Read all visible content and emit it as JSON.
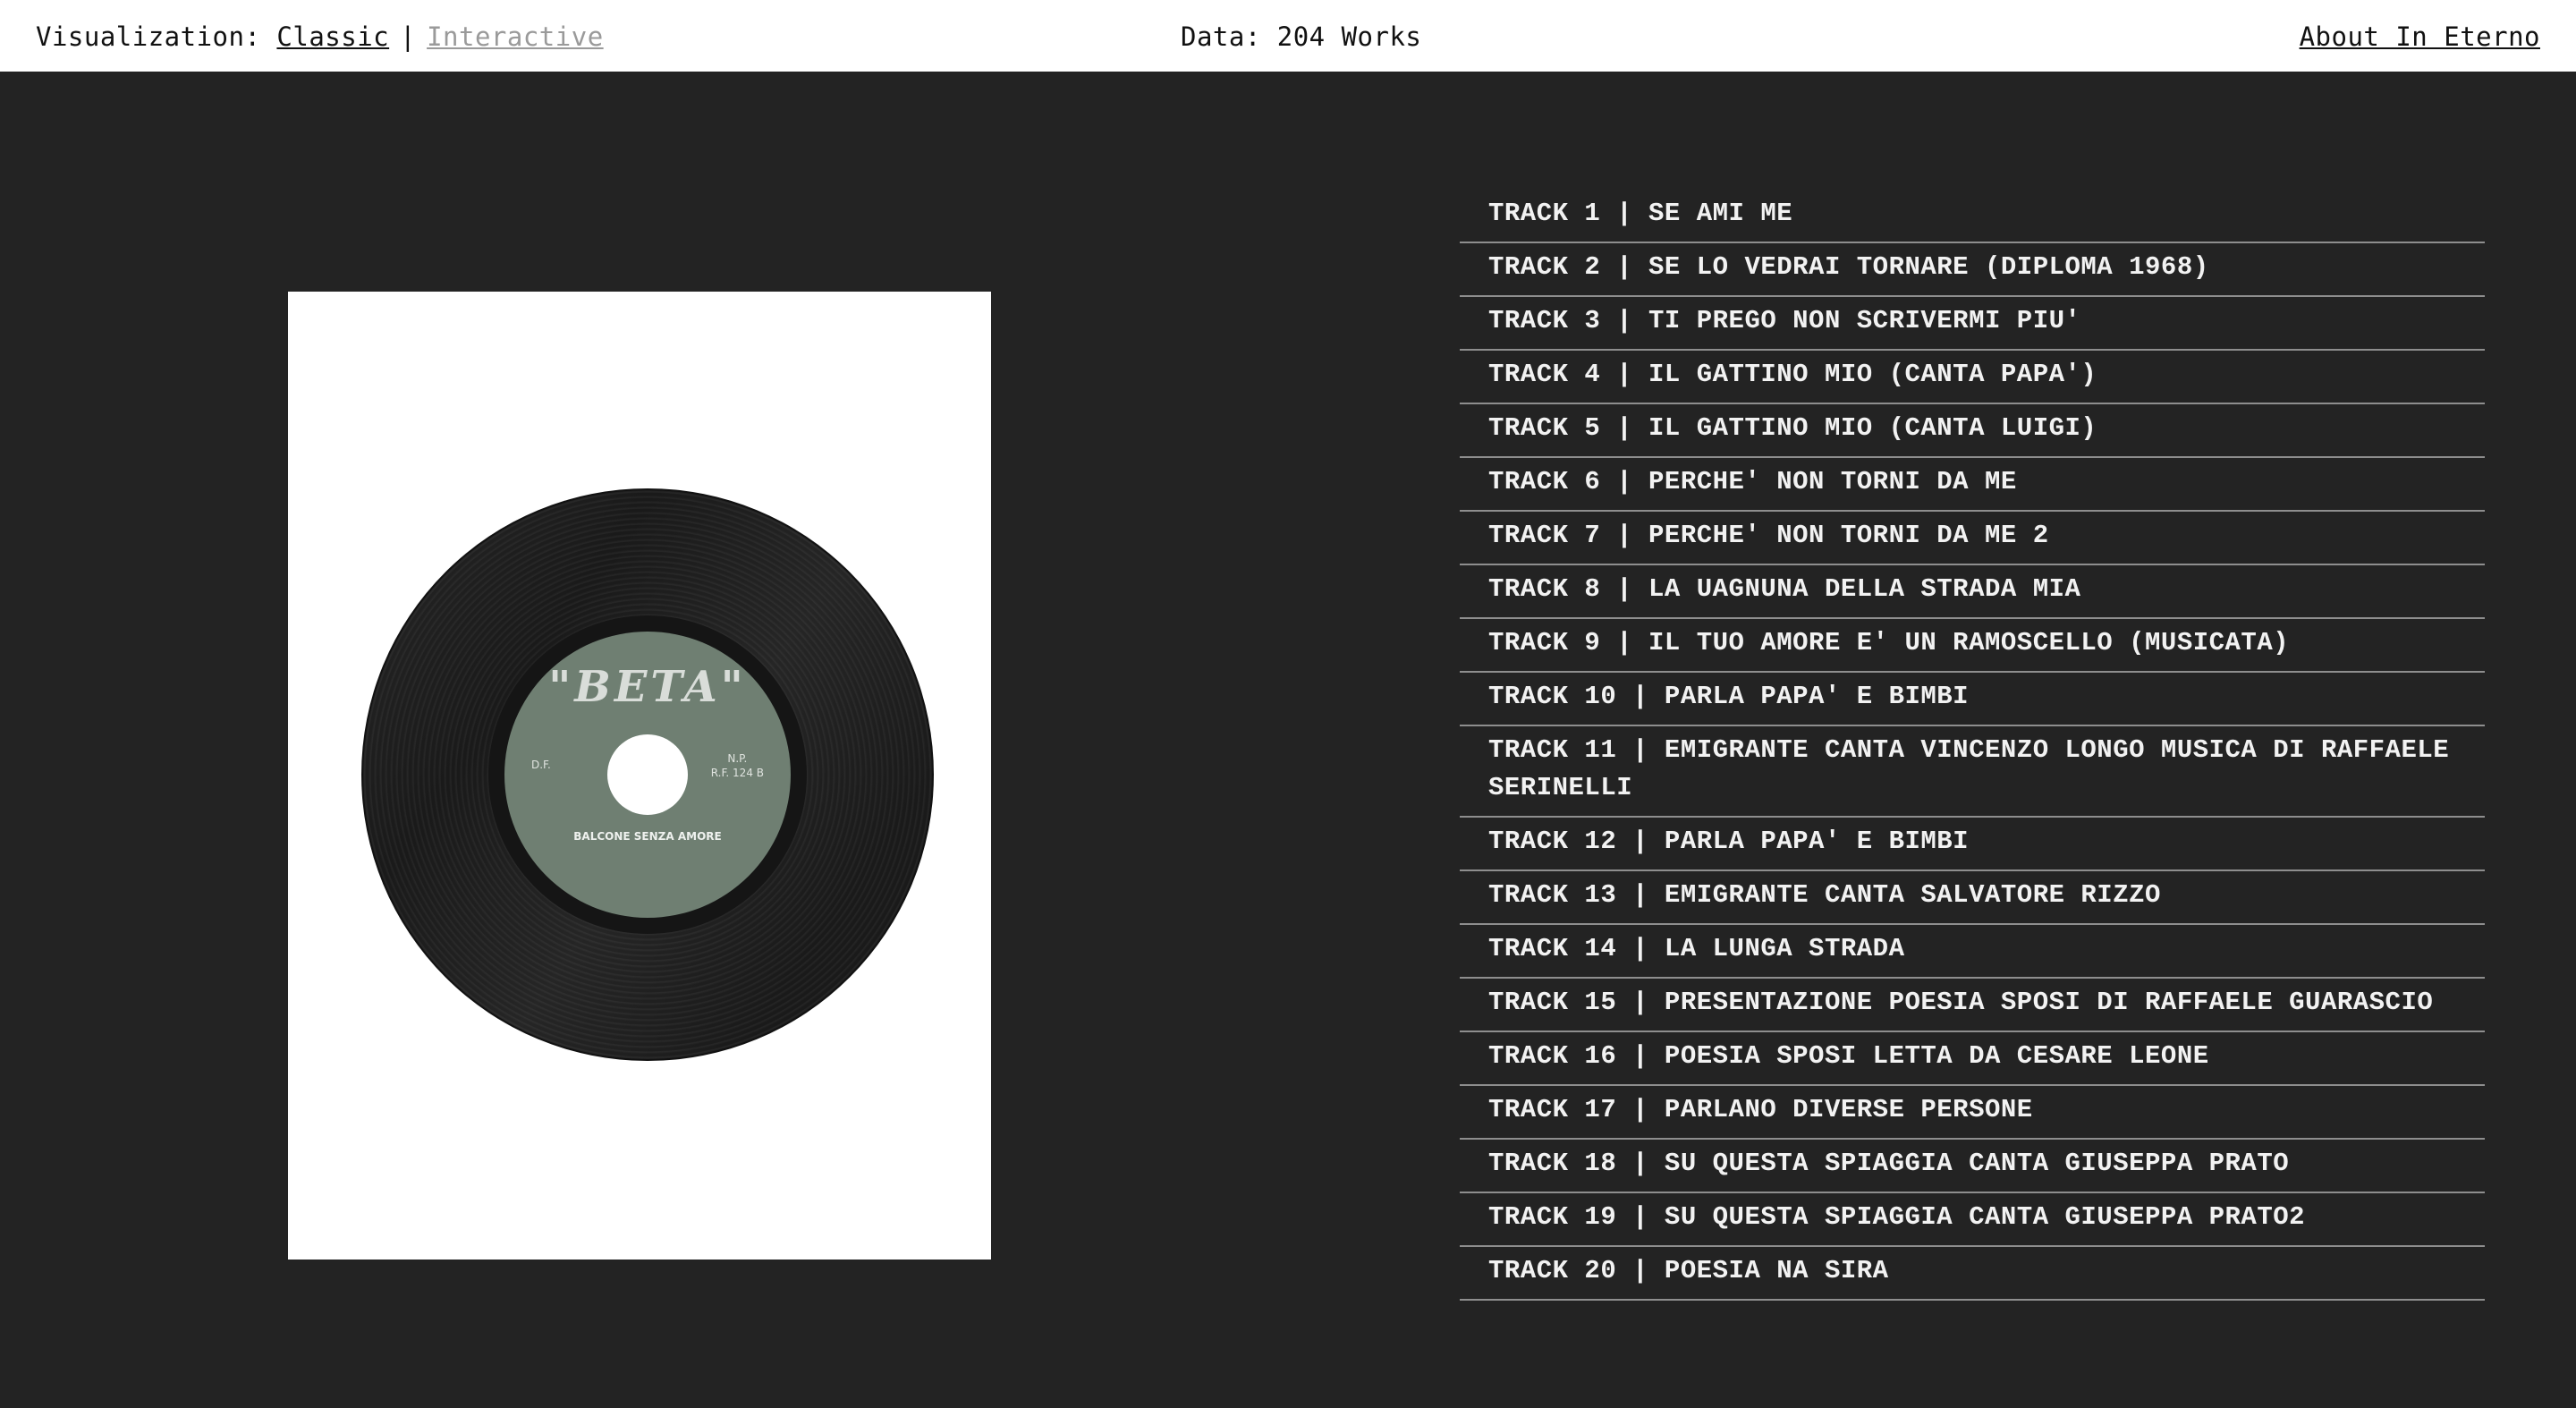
{
  "header": {
    "visualization_label": "Visualization:",
    "classic": "Classic",
    "separator": "|",
    "interactive": "Interactive",
    "data_count": "Data: 204 Works",
    "about": "About In Eterno"
  },
  "record_label": {
    "brand": "\"BETA\"",
    "left_code": "D.F.",
    "right_code_1": "N.P.",
    "right_code_2": "R.F. 124 B",
    "title": "BALCONE SENZA AMORE"
  },
  "tracks": [
    "TRACK 1 | SE AMI ME",
    "TRACK 2 | SE LO VEDRAI TORNARE (DIPLOMA 1968)",
    "TRACK 3 | TI PREGO NON SCRIVERMI PIU'",
    "TRACK 4 | IL GATTINO MIO (CANTA PAPA')",
    "TRACK 5 | IL GATTINO MIO (CANTA LUIGI)",
    "TRACK 6 | PERCHE' NON TORNI DA ME",
    "TRACK 7 | PERCHE' NON TORNI DA ME 2",
    "TRACK 8 | LA UAGNUNA DELLA STRADA MIA",
    "TRACK 9 | IL TUO AMORE E' UN RAMOSCELLO (MUSICATA)",
    "TRACK 10 | PARLA PAPA' E BIMBI",
    "TRACK 11 | EMIGRANTE CANTA VINCENZO LONGO MUSICA DI RAFFAELE SERINELLI",
    "TRACK 12 | PARLA PAPA' E BIMBI",
    "TRACK 13 | EMIGRANTE CANTA SALVATORE RIZZO",
    "TRACK 14 | LA LUNGA STRADA",
    "TRACK 15 | PRESENTAZIONE POESIA SPOSI DI RAFFAELE GUARASCIO",
    "TRACK 16 | POESIA SPOSI LETTA DA CESARE LEONE",
    "TRACK 17 | PARLANO DIVERSE PERSONE",
    "TRACK 18 | SU QUESTA SPIAGGIA CANTA GIUSEPPA PRATO",
    "TRACK 19 | SU QUESTA SPIAGGIA CANTA GIUSEPPA PRATO2",
    "TRACK 20 | POESIA NA SIRA"
  ]
}
